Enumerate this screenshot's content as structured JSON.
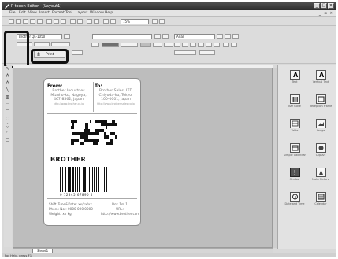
{
  "window": {
    "title": "P-touch Editor - [Layout1]"
  },
  "menu": {
    "items": [
      "File",
      "Edit",
      "View",
      "Insert",
      "Format",
      "Tool",
      "Layout",
      "Window",
      "Help"
    ]
  },
  "toolbar": {
    "printer": "Brother QL-1050",
    "font": "Arial",
    "print_button": "Print",
    "zoom": "75%"
  },
  "label": {
    "from_title": "From:",
    "from_lines": [
      "Brother Industries",
      "Mizuho-ku, Nagoya,",
      "467-8562, Japan"
    ],
    "from_url": "http://www.brother.co.jp",
    "to_title": "To:",
    "to_lines": [
      "Brother Sales, LTD",
      "Chiyoda-ku, Tokyo,",
      "100-0001, Japan"
    ],
    "to_url": "http://www.brother-sales.co.jp",
    "brand": "BROTHER",
    "barcode_digits": "0 12345 67890 5",
    "footer": {
      "left": [
        "Shift Time&Date: xx/xx/xx",
        "Phone No.: 0000 000 0000",
        "Weight: xx kg"
      ],
      "right": [
        "Box 1of 1",
        "URL:",
        "http://www.brother.com"
      ]
    }
  },
  "right_panel": {
    "items": [
      "Text",
      "Vertical Text",
      "Bar Code",
      "Reception Frame",
      "Table",
      "Image",
      "Simple Calendar",
      "Clip Art",
      "Symbol",
      "Make Picture",
      "Date and Time",
      "Calendar"
    ]
  },
  "sheet_tab": "Sheet1",
  "status": "For Help, press F1"
}
